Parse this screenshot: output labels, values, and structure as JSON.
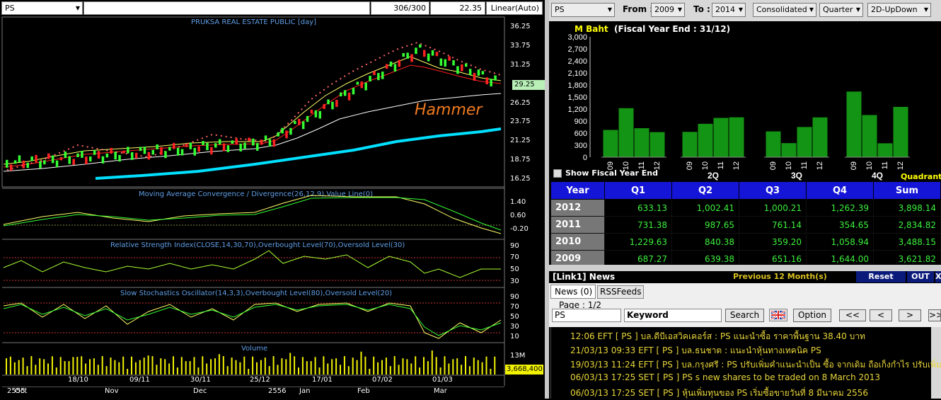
{
  "left_toolbar": {
    "symbol": "PS",
    "counter": "306/300",
    "price": "22.35",
    "scale": "Linear(Auto)"
  },
  "main_chart": {
    "title": "PRUKSA REAL ESTATE PUBLIC [day]",
    "annotation": "Hammer",
    "current_price": "29.25",
    "yticks": [
      "36.25",
      "33.75",
      "31.25",
      "28.75",
      "26.25",
      "23.75",
      "21.25",
      "18.75",
      "16.25"
    ]
  },
  "macd": {
    "title": "Moving Average Convergence / Divergence(26,12,9),Value Line(0)",
    "yticks": [
      "1.40",
      "0.60",
      "-0.20"
    ]
  },
  "rsi": {
    "title": "Relative Strength Index(CLOSE,14,30,70),Overbought Level(70),Oversold Level(30)",
    "yticks": [
      "90",
      "70",
      "50",
      "30"
    ]
  },
  "stoch": {
    "title": "Slow Stochastics Oscillator(14,3,3),Overbought Level(80),Oversold Level(20)",
    "yticks": [
      "90",
      "70",
      "50",
      "30",
      "10"
    ]
  },
  "volume": {
    "title": "Volume",
    "ytick": "13M",
    "last_value": "3,668,400"
  },
  "date_axis": {
    "top": [
      "18/10",
      "09/11",
      "30/11",
      "25/12",
      "17/01",
      "07/02",
      "01/03"
    ],
    "bottom": [
      "2555",
      "Oct",
      "Nov",
      "Dec",
      "2556",
      "Jan",
      "Feb",
      "Mar"
    ]
  },
  "right_toolbar": {
    "symbol": "PS",
    "from_label": "From :",
    "from": "2009",
    "to_label": "To :",
    "to": "2014",
    "consolidated": "Consolidated",
    "period": "Quarter",
    "chart_mode": "2D-UpDown"
  },
  "financial_chart": {
    "unit": "M Baht",
    "fiscal": "(Fiscal Year End : 31/12)",
    "show_fiscal": "Show Fiscal Year End",
    "quadrant_label": "Quadrant",
    "group_labels": [
      "",
      "2Q",
      "3Q",
      "4Q"
    ],
    "year_ticks": [
      "09",
      "10",
      "11",
      "12"
    ],
    "yticks": [
      "3,000",
      "2,700",
      "2,400",
      "2,100",
      "1,800",
      "1,500",
      "1,200",
      "900",
      "600",
      "300",
      "0"
    ]
  },
  "chart_data": {
    "type": "bar",
    "ylabel": "M Baht",
    "ylim": [
      0,
      3000
    ],
    "categories": [
      "Q1",
      "Q2",
      "Q3",
      "Q4"
    ],
    "series": [
      {
        "name": "2009",
        "values": [
          687.27,
          639.38,
          651.16,
          1644.0
        ]
      },
      {
        "name": "2010",
        "values": [
          1229.63,
          840.38,
          359.2,
          1058.94
        ]
      },
      {
        "name": "2011",
        "values": [
          731.38,
          987.65,
          761.14,
          354.65
        ]
      },
      {
        "name": "2012",
        "values": [
          633.13,
          1002.41,
          1000.21,
          1262.39
        ]
      }
    ]
  },
  "financial_table": {
    "headers": [
      "Year",
      "Q1",
      "Q2",
      "Q3",
      "Q4",
      "Sum"
    ],
    "rows": [
      [
        "2012",
        "633.13",
        "1,002.41",
        "1,000.21",
        "1,262.39",
        "3,898.14"
      ],
      [
        "2011",
        "731.38",
        "987.65",
        "761.14",
        "354.65",
        "2,834.82"
      ],
      [
        "2010",
        "1,229.63",
        "840.38",
        "359.20",
        "1,058.94",
        "3,488.15"
      ],
      [
        "2009",
        "687.27",
        "639.38",
        "651.16",
        "1,644.00",
        "3,621.82"
      ]
    ]
  },
  "news_panel": {
    "title": "[Link1] News",
    "range": "Previous 12 Month(s)",
    "reset": "Reset",
    "out": "OUT",
    "close": "X",
    "tabs": [
      "News (0)",
      "RSSFeeds"
    ],
    "page": "Page : 1/2",
    "search_value": "PS",
    "keyword_label": "Keyword",
    "search_btn": "Search",
    "option_btn": "Option",
    "nav": [
      "<<",
      "<",
      ">",
      ">>"
    ],
    "items": [
      "12:06  EFT  [ PS ]  บล.ดีบีเอสวิคเคอร์ส : PS แนะนำซื้อ ราคาพื้นฐาน 38.40 บาท",
      "21/03/13 09:33  EFT  [ PS ]  บล.ธนชาต : แนะนำหุ้นทางเทคนิค PS",
      "19/03/13 11:24  EFT  [ PS ]  บล.กรุงศรี : PS ปรับเพิ่มคำแนะนำเป็น ซื้อ จากเดิม ถือเก็งกำไร ปรับเพิ่ม...",
      "06/03/13 17:25  SET  [ PS ]  PS s new shares to be traded on 8 March 2013",
      "06/03/13 17:25  SET  [ PS ]  หุ้นเพิ่มทุนของ PS เริ่มซื้อขายวันที่ 8 มีนาคม 2556"
    ]
  }
}
